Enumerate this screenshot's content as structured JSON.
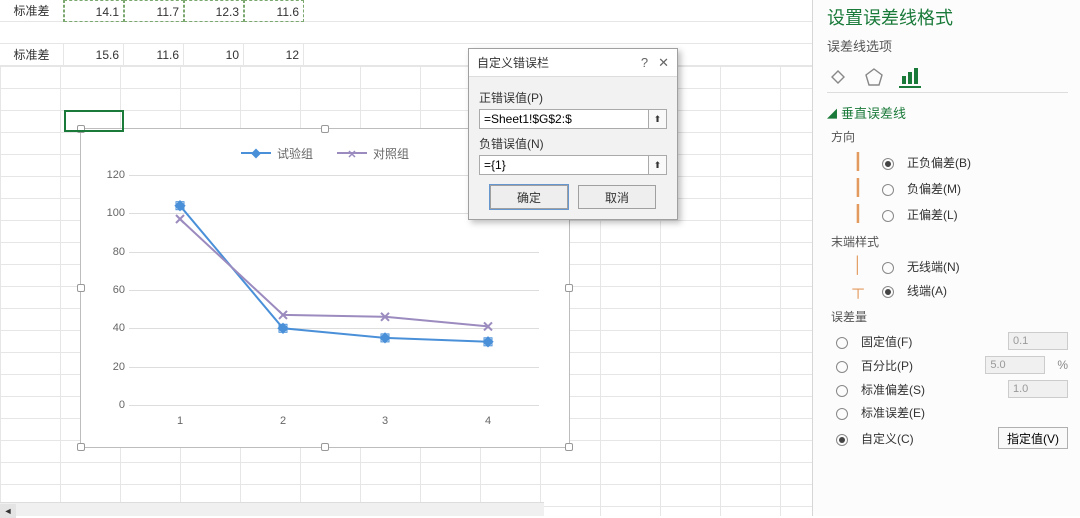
{
  "grid": {
    "row1_label": "标准差",
    "row1_values": [
      "14.1",
      "11.7",
      "12.3",
      "11.6"
    ],
    "row2_label": "标准差",
    "row2_values": [
      "15.6",
      "11.6",
      "10",
      "12"
    ]
  },
  "chart_data": {
    "type": "line",
    "categories": [
      "1",
      "2",
      "3",
      "4"
    ],
    "series": [
      {
        "name": "试验组",
        "values": [
          104,
          40,
          35,
          33
        ],
        "color": "#4a90d9",
        "marker": "diamond"
      },
      {
        "name": "对照组",
        "values": [
          97,
          47,
          46,
          41
        ],
        "color": "#9b8bbf",
        "marker": "x"
      }
    ],
    "ylim": [
      0,
      120
    ],
    "y_ticks": [
      0,
      20,
      40,
      60,
      80,
      100,
      120
    ],
    "xlabel": "",
    "ylabel": "",
    "title": ""
  },
  "dialog": {
    "title": "自定义错误栏",
    "pos_label": "正错误值(P)",
    "pos_value": "=Sheet1!$G$2:$",
    "neg_label": "负错误值(N)",
    "neg_value": "={1}",
    "ok": "确定",
    "cancel": "取消"
  },
  "pane": {
    "title_truncated": "设置误差线格式",
    "subtitle": "误差线选项",
    "section_vertical": "垂直误差线",
    "direction_h": "方向",
    "direction_opts": {
      "both": "正负偏差(B)",
      "minus": "负偏差(M)",
      "plus": "正偏差(L)"
    },
    "direction_selected": "both",
    "endstyle_h": "末端样式",
    "endstyle_opts": {
      "none": "无线端(N)",
      "cap": "线端(A)"
    },
    "endstyle_selected": "cap",
    "amount_h": "误差量",
    "amount_opts": {
      "fixed": "固定值(F)",
      "percent": "百分比(P)",
      "stddev": "标准偏差(S)",
      "stderr": "标准误差(E)",
      "custom": "自定义(C)"
    },
    "amount_selected": "custom",
    "fixed_val": "0.1",
    "percent_val": "5.0",
    "stddev_val": "1.0",
    "specify_btn": "指定值(V)",
    "percent_sign": "%"
  }
}
